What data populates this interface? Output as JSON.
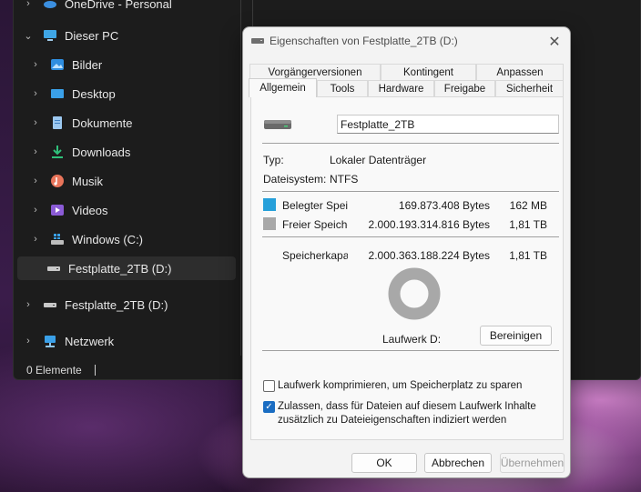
{
  "explorer": {
    "nav": {
      "top_item": "OneDrive - Personal",
      "this_pc": "Dieser PC",
      "items": [
        {
          "label": "Bilder",
          "icon": "pictures-icon"
        },
        {
          "label": "Desktop",
          "icon": "desktop-icon"
        },
        {
          "label": "Dokumente",
          "icon": "documents-icon"
        },
        {
          "label": "Downloads",
          "icon": "downloads-icon"
        },
        {
          "label": "Musik",
          "icon": "music-icon"
        },
        {
          "label": "Videos",
          "icon": "videos-icon"
        },
        {
          "label": "Windows (C:)",
          "icon": "windows-drive-icon"
        },
        {
          "label": "Festplatte_2TB (D:)",
          "icon": "drive-icon"
        }
      ],
      "drive_root": "Festplatte_2TB (D:)",
      "network": "Netzwerk"
    },
    "status": "0 Elemente"
  },
  "dialog": {
    "title": "Eigenschaften von Festplatte_2TB (D:)",
    "tabs_row1": [
      "Vorgängerversionen",
      "Kontingent",
      "Anpassen"
    ],
    "tabs_row2": [
      "Allgemein",
      "Tools",
      "Hardware",
      "Freigabe",
      "Sicherheit"
    ],
    "active_tab": "Allgemein",
    "drive_name": "Festplatte_2TB",
    "type_label": "Typ:",
    "type_value": "Lokaler Datenträger",
    "fs_label": "Dateisystem:",
    "fs_value": "NTFS",
    "used_label": "Belegter Speich",
    "used_bytes": "169.873.408 Bytes",
    "used_size": "162 MB",
    "free_label": "Freier Speicher",
    "free_bytes": "2.000.193.314.816 Bytes",
    "free_size": "1,81 TB",
    "capacity_label": "Speicherkapazi",
    "capacity_bytes": "2.000.363.188.224 Bytes",
    "capacity_size": "1,81 TB",
    "drive_caption": "Laufwerk D:",
    "cleanup_button": "Bereinigen",
    "compress_label": "Laufwerk komprimieren, um Speicherplatz zu sparen",
    "compress_checked": false,
    "index_label_1": "Zulassen, dass für Dateien auf diesem Laufwerk Inhalte",
    "index_label_2": "zusätzlich zu Dateieigenschaften indiziert werden",
    "index_checked": true,
    "ok_button": "OK",
    "cancel_button": "Abbrechen",
    "apply_button": "Übernehmen",
    "used_color": "#26a0da",
    "free_color": "#a8a8a8",
    "used_fraction": 0.0001
  }
}
